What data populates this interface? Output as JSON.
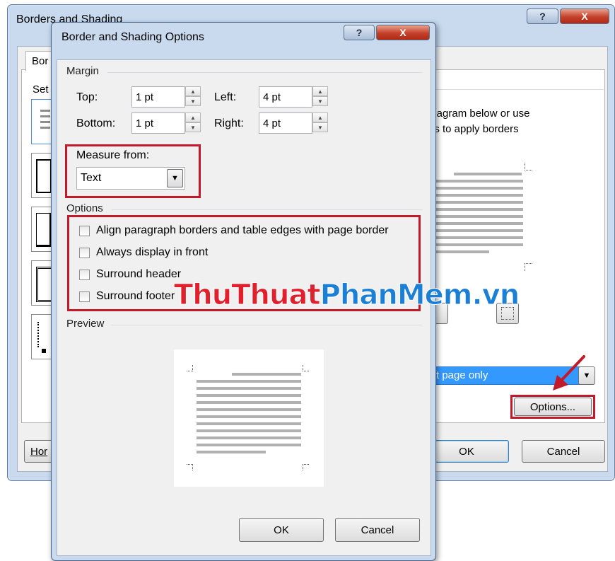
{
  "outer_dialog": {
    "title": "Borders and Shading",
    "help_label": "?",
    "close_label": "X",
    "tab_label": "Bor",
    "setting_label": "Set",
    "instructions_line1": "diagram below or use",
    "instructions_line2": "ns to apply borders",
    "apply_to_value": "t page only",
    "options_button": "Options...",
    "horizontal_button": "Hor",
    "ok_button": "OK",
    "cancel_button": "Cancel"
  },
  "inner_dialog": {
    "title": "Border and Shading Options",
    "help_label": "?",
    "close_label": "X",
    "margin_group": "Margin",
    "top_label": "Top:",
    "top_value": "1 pt",
    "bottom_label": "Bottom:",
    "bottom_value": "1 pt",
    "left_label": "Left:",
    "left_value": "4 pt",
    "right_label": "Right:",
    "right_value": "4 pt",
    "measure_from_label": "Measure from:",
    "measure_from_value": "Text",
    "options_group": "Options",
    "options": [
      {
        "label": "Align paragraph borders and table edges with page border",
        "checked": false
      },
      {
        "label": "Always display in front",
        "checked": false
      },
      {
        "label": "Surround header",
        "checked": false
      },
      {
        "label": "Surround footer",
        "checked": false
      }
    ],
    "preview_group": "Preview",
    "ok_button": "OK",
    "cancel_button": "Cancel"
  },
  "watermark": {
    "part1": "ThuThuat",
    "part2": "PhanMem",
    "part3": ".vn",
    "color1": "#e0202d",
    "color2": "#1b7fd6"
  },
  "colors": {
    "highlight_red": "#c21a2a",
    "selection_blue": "#3399ff"
  }
}
